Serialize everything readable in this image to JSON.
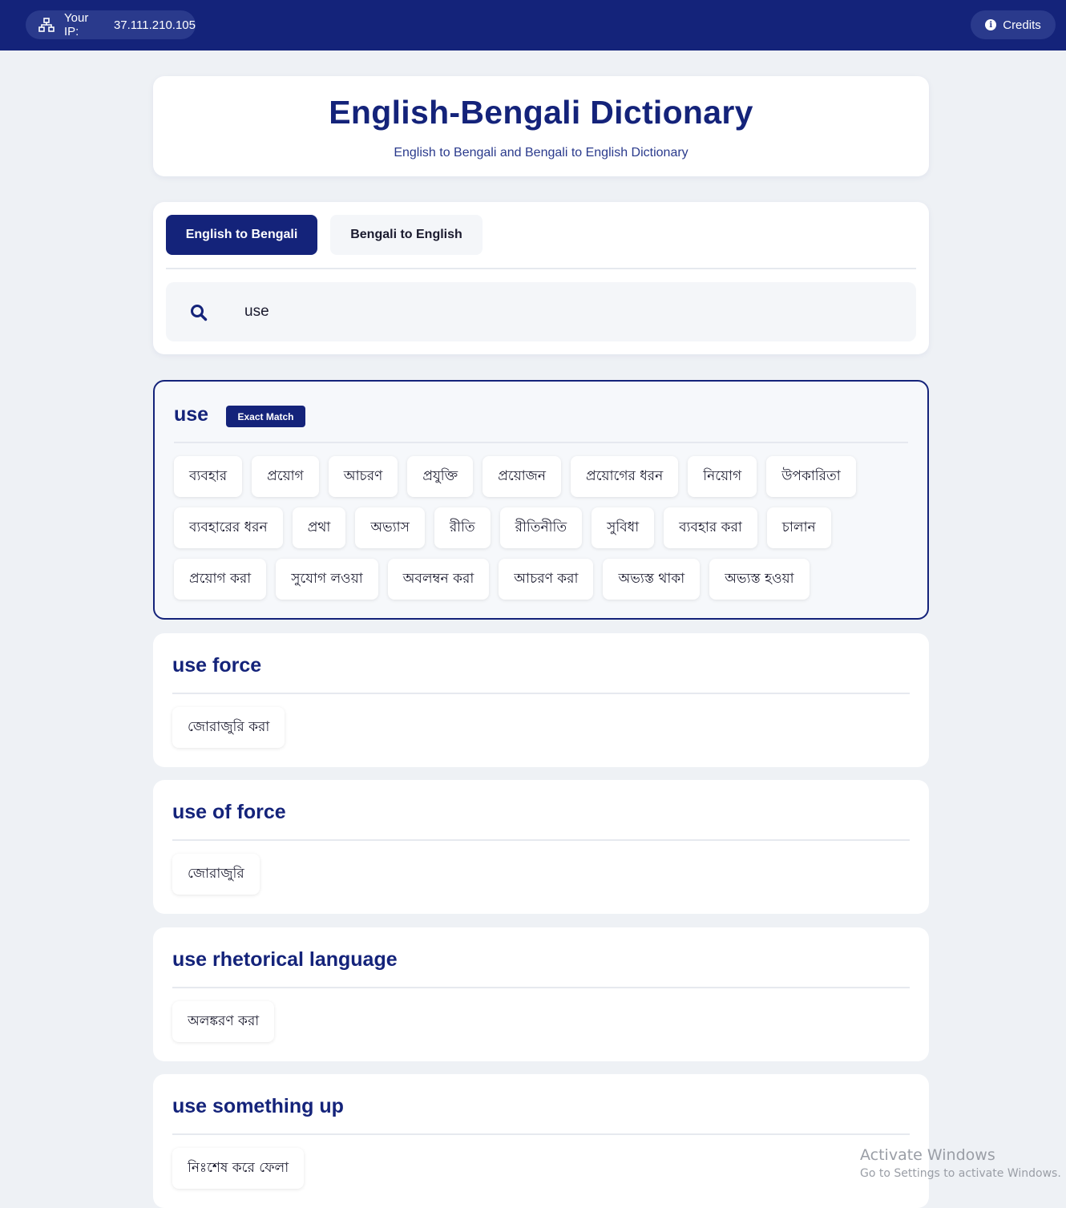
{
  "topbar": {
    "ip_label": "Your IP:",
    "ip_value": "37.111.210.105",
    "credits_label": "Credits"
  },
  "hero": {
    "title": "English-Bengali Dictionary",
    "subtitle": "English to Bengali and Bengali to English Dictionary"
  },
  "search": {
    "tabs": [
      {
        "label": "English to Bengali",
        "active": true
      },
      {
        "label": "Bengali to English",
        "active": false
      }
    ],
    "query": "use"
  },
  "results": {
    "exact": {
      "word": "use",
      "badge": "Exact Match",
      "meanings": [
        "ব্যবহার",
        "প্রয়োগ",
        "আচরণ",
        "প্রযুক্তি",
        "প্রয়োজন",
        "প্রয়োগের ধরন",
        "নিয়োগ",
        "উপকারিতা",
        "ব্যবহারের ধরন",
        "প্রথা",
        "অভ্যাস",
        "রীতি",
        "রীতিনীতি",
        "সুবিধা",
        "ব্যবহার করা",
        "চালান",
        "প্রয়োগ করা",
        "সুযোগ লওয়া",
        "অবলম্বন করা",
        "আচরণ করা",
        "অভ্যস্ত থাকা",
        "অভ্যস্ত হওয়া"
      ]
    },
    "others": [
      {
        "word": "use force",
        "meanings": [
          "জোরাজুরি করা"
        ]
      },
      {
        "word": "use of force",
        "meanings": [
          "জোরাজুরি"
        ]
      },
      {
        "word": "use rhetorical language",
        "meanings": [
          "অলঙ্করণ করা"
        ]
      },
      {
        "word": "use something up",
        "meanings": [
          "নিঃশেষ করে ফেলা"
        ]
      }
    ]
  },
  "watermark": {
    "title": "Activate Windows",
    "subtitle": "Go to Settings to activate Windows."
  },
  "colors": {
    "primary": "#14237a",
    "background": "#eef1f5",
    "card": "#ffffff"
  }
}
